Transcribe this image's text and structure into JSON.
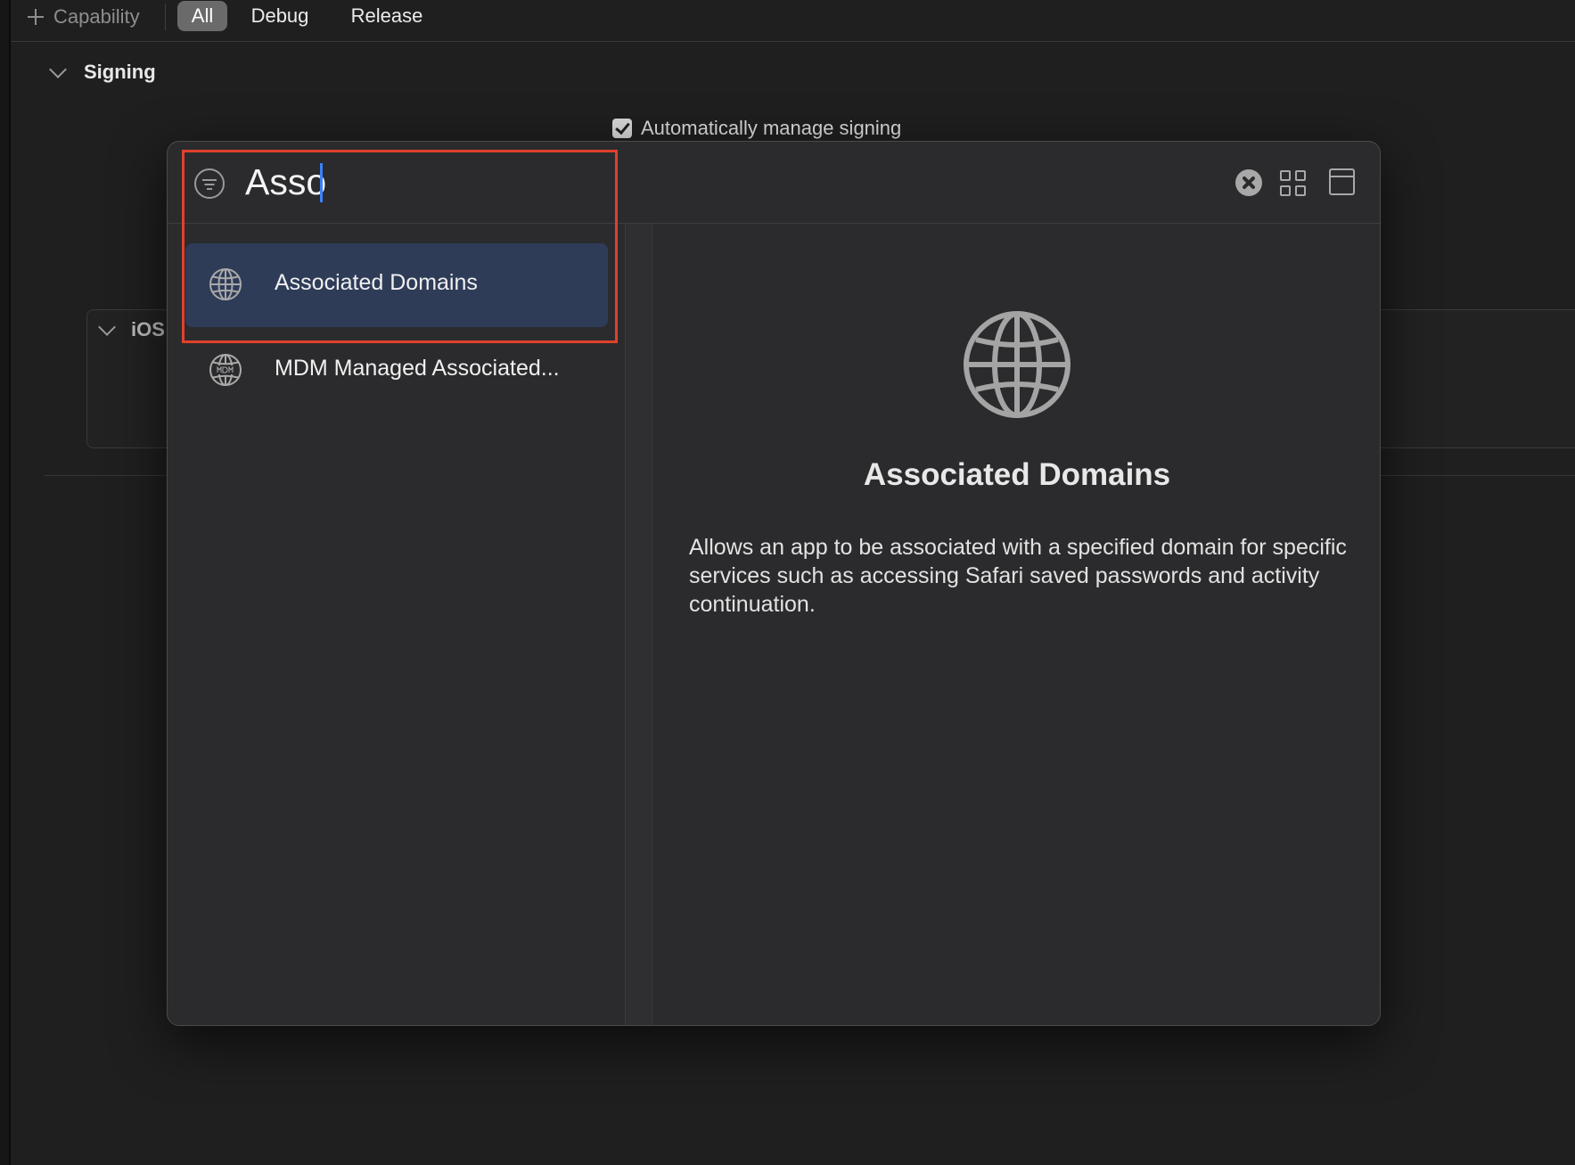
{
  "toolbar": {
    "add_capability_label": "Capability",
    "filters": [
      {
        "label": "All",
        "selected": true
      },
      {
        "label": "Debug",
        "selected": false
      },
      {
        "label": "Release",
        "selected": false
      }
    ]
  },
  "signing": {
    "section_title": "Signing",
    "auto_manage_label": "Automatically manage signing",
    "auto_manage_checked": true
  },
  "ios_section": {
    "title": "iOS"
  },
  "capability_library": {
    "search": {
      "value": "Asso"
    },
    "results": [
      {
        "label": "Associated Domains",
        "icon": "globe-icon",
        "selected": true
      },
      {
        "label": "MDM Managed Associated...",
        "icon": "mdm-globe-icon",
        "selected": false
      }
    ],
    "detail": {
      "title": "Associated Domains",
      "icon": "globe-icon",
      "description": "Allows an app to be associated with a specified domain for specific services such as accessing Safari saved passwords and activity continuation."
    }
  },
  "colors": {
    "background": "#1f1f1f",
    "sheet": "#2b2b2d",
    "selection": "#2f3c58",
    "highlight_annotation": "#e0412c",
    "caret": "#3b82f6"
  }
}
